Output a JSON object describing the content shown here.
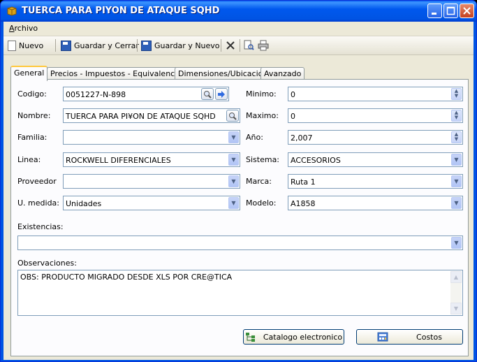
{
  "window": {
    "title": "TUERCA PARA PIYON DE ATAQUE SQHD"
  },
  "menu": {
    "archivo_first": "A",
    "archivo_rest": "rchivo"
  },
  "toolbar": {
    "nuevo": "Nuevo",
    "guardar_cerrar": "Guardar y Cerrar",
    "guardar_nuevo": "Guardar y Nuevo"
  },
  "tabs": [
    "General",
    "Precios - Impuestos - Equivalencias",
    "Dimensiones/Ubicacion",
    "Avanzado"
  ],
  "form": {
    "codigo": {
      "label": "Codigo:",
      "value": "0051227-N-898"
    },
    "nombre": {
      "label": "Nombre:",
      "value": "TUERCA PARA PI¥ON DE ATAQUE SQHD"
    },
    "familia": {
      "label": "Familia:",
      "value": ""
    },
    "linea": {
      "label": "Linea:",
      "value": "ROCKWELL DIFERENCIALES"
    },
    "proveedor": {
      "label": "Proveedor",
      "value": ""
    },
    "umedida": {
      "label": "U. medida:",
      "value": "Unidades"
    },
    "minimo": {
      "label": "Minimo:",
      "value": "0"
    },
    "maximo": {
      "label": "Maximo:",
      "value": "0"
    },
    "anio": {
      "label": "Año:",
      "value": "2,007"
    },
    "sistema": {
      "label": "Sistema:",
      "value": "ACCESORIOS"
    },
    "marca": {
      "label": "Marca:",
      "value": "Ruta 1"
    },
    "modelo": {
      "label": "Modelo:",
      "value": "A1858"
    },
    "existencias": {
      "label": "Existencias:",
      "value": ""
    },
    "observaciones": {
      "label": "Observaciones:",
      "value": "OBS: PRODUCTO MIGRADO DESDE XLS POR CRE@TICA"
    }
  },
  "buttons": {
    "catalogo": "Catalogo electronico",
    "costos": "Costos"
  }
}
